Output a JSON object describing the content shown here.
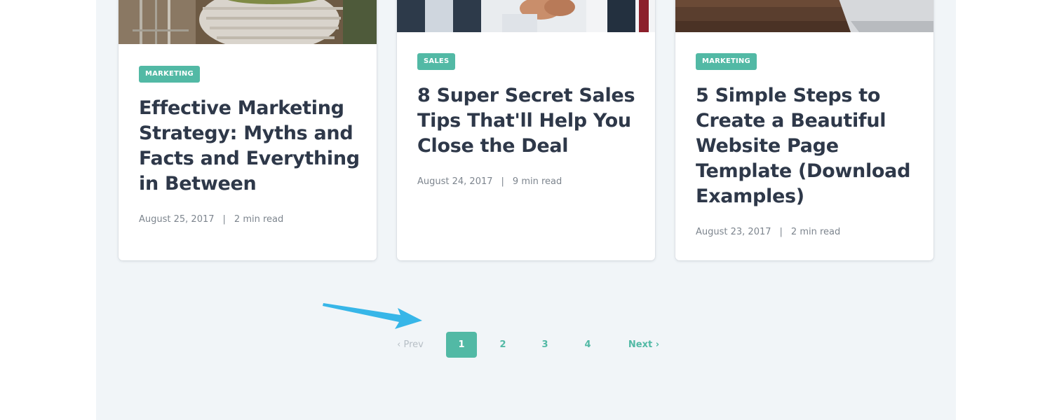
{
  "cards": [
    {
      "image_icon": "garden-basket-photo",
      "tag": "MARKETING",
      "title": "Effective Marketing Strategy: Myths and Facts and Everything in Between",
      "date": "August 25, 2017",
      "separator": "|",
      "read_time": "2 min read"
    },
    {
      "image_icon": "handshake-photo",
      "tag": "SALES",
      "title": "8 Super Secret Sales Tips That'll Help You Close the Deal",
      "date": "August 24, 2017",
      "separator": "|",
      "read_time": "9 min read"
    },
    {
      "image_icon": "laptop-desk-photo",
      "tag": "MARKETING",
      "title": "5 Simple Steps to Create a Beautiful Website Page Template (Download Examples)",
      "date": "August 23, 2017",
      "separator": "|",
      "read_time": "2 min read"
    }
  ],
  "pagination": {
    "prev_label": "‹ Prev",
    "pages": [
      "1",
      "2",
      "3",
      "4"
    ],
    "active_page": "1",
    "next_label": "Next ›"
  },
  "annotation": {
    "icon": "arrow-pointer-icon"
  },
  "colors": {
    "accent": "#52b9a5",
    "page_background": "#f1f5f8",
    "title_text": "#2e3849",
    "meta_text": "#7d858e",
    "arrow": "#37b6e8"
  }
}
